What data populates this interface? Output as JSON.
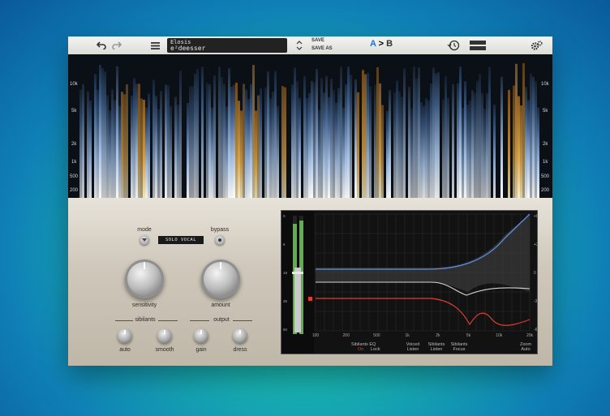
{
  "toolbar": {
    "undo_icon": "undo-arrow-icon",
    "redo_icon": "redo-arrow-icon",
    "menu_icon": "hamburger-menu-icon",
    "preset_line1": "Elosis",
    "preset_line2": "e²deesser",
    "save_label": "SAVE",
    "save_as_label": "SAVE AS",
    "a_label": "A",
    "arrow_label": ">",
    "b_label": "B",
    "history_icon": "history-clock-icon",
    "layout_icon": "layout-toggle-icon",
    "settings_icon": "gears-icon"
  },
  "spectrogram": {
    "freq_labels": [
      "10k",
      "5k",
      "2k",
      "1k",
      "500",
      "200"
    ]
  },
  "controls": {
    "mode_label": "mode",
    "mode_value": "SOLO VOCAL",
    "bypass_label": "bypass",
    "sensitivity_label": "sensitivity",
    "amount_label": "amount",
    "sibilants_group": "sibilants",
    "output_group": "output",
    "auto_label": "auto",
    "smooth_label": "smooth",
    "gain_label": "gain",
    "dress_label": "dress"
  },
  "eq": {
    "x_ticks": [
      "100",
      "200",
      "500",
      "1k",
      "2k",
      "5k",
      "10k",
      "20k"
    ],
    "y_ticks": [
      "+6",
      "+3",
      "0",
      "-3",
      "-6"
    ],
    "meter_ticks": [
      "0",
      "6",
      "18",
      "36",
      "60"
    ],
    "footer": {
      "sibilants_eq": "Sibilants EQ",
      "on": "On",
      "lock": "Lock",
      "voiced_listen": [
        "Voiced",
        "Listen"
      ],
      "sibilants_listen": [
        "Sibilants",
        "Listen"
      ],
      "sibilants_focus": [
        "Sibilants",
        "Focus"
      ],
      "zoom": [
        "Zoom",
        "Auto"
      ]
    }
  },
  "colors": {
    "accent_blue": "#2b6fd0",
    "curve_blue": "#5a8ee0",
    "curve_red": "#d8402f",
    "meter_green": "#5fb04a"
  }
}
